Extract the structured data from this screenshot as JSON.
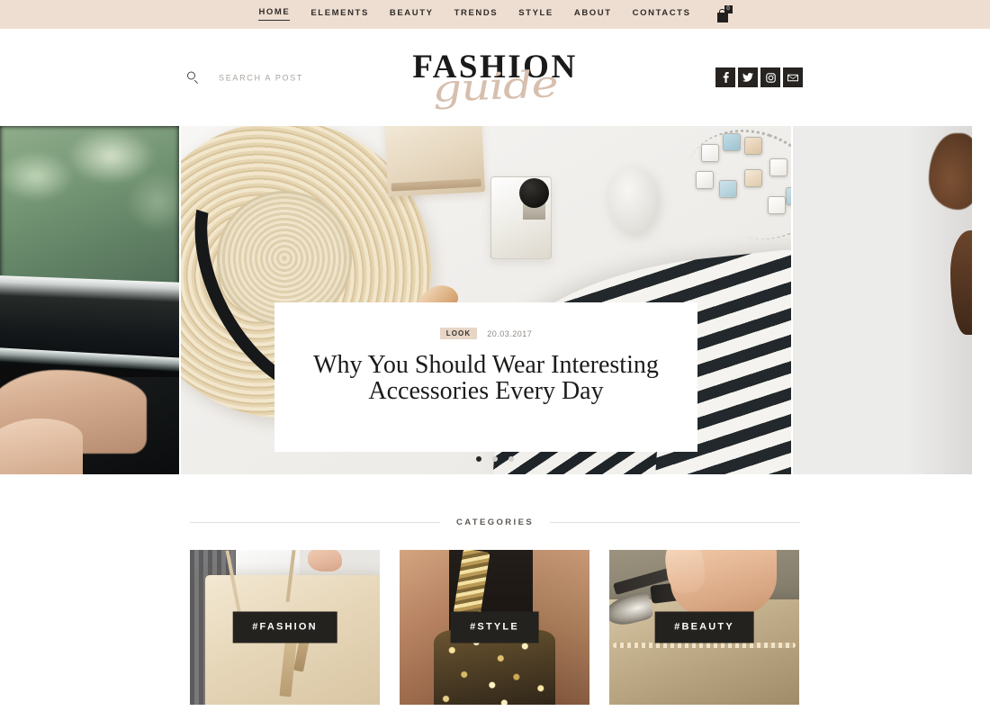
{
  "topnav": {
    "items": [
      {
        "label": "HOME",
        "active": true
      },
      {
        "label": "ELEMENTS",
        "active": false
      },
      {
        "label": "BEAUTY",
        "active": false
      },
      {
        "label": "TRENDS",
        "active": false
      },
      {
        "label": "STYLE",
        "active": false
      },
      {
        "label": "ABOUT",
        "active": false
      },
      {
        "label": "CONTACTS",
        "active": false
      }
    ],
    "cart": {
      "icon": "shopping-bag-icon",
      "badge": "0"
    },
    "background_color": "#eeded1"
  },
  "header": {
    "search": {
      "icon": "search-icon",
      "placeholder": "SEARCH A POST",
      "value": ""
    },
    "logo": {
      "main": "FASHION",
      "script": "guide",
      "script_color": "#d7bfae"
    },
    "socials": [
      {
        "name": "facebook-icon",
        "glyph": "f"
      },
      {
        "name": "twitter-icon",
        "glyph": "t"
      },
      {
        "name": "instagram-icon",
        "glyph": "i"
      },
      {
        "name": "email-icon",
        "glyph": "m"
      }
    ]
  },
  "hero": {
    "slide": {
      "category": "LOOK",
      "date": "20.03.2017",
      "title": "Why You Should Wear Interesting Accessories Every Day",
      "category_badge_color": "#e7d6c6"
    },
    "dots": [
      {
        "active": true
      },
      {
        "active": false
      },
      {
        "active": false
      }
    ],
    "side_left_alt": "blurred-car-window-photo",
    "side_right_alt": "light-studio-photo",
    "center_alt": "flat-lay-straw-hat-perfume-necklace-striped-shirt"
  },
  "categories": {
    "section_title": "CATEGORIES",
    "cards": [
      {
        "label": "#FASHION",
        "image_alt": "cream-tote-bag"
      },
      {
        "label": "#STYLE",
        "image_alt": "gold-sequin-dress"
      },
      {
        "label": "#BEAUTY",
        "image_alt": "makeup-brushes-gold-pouch"
      }
    ]
  }
}
